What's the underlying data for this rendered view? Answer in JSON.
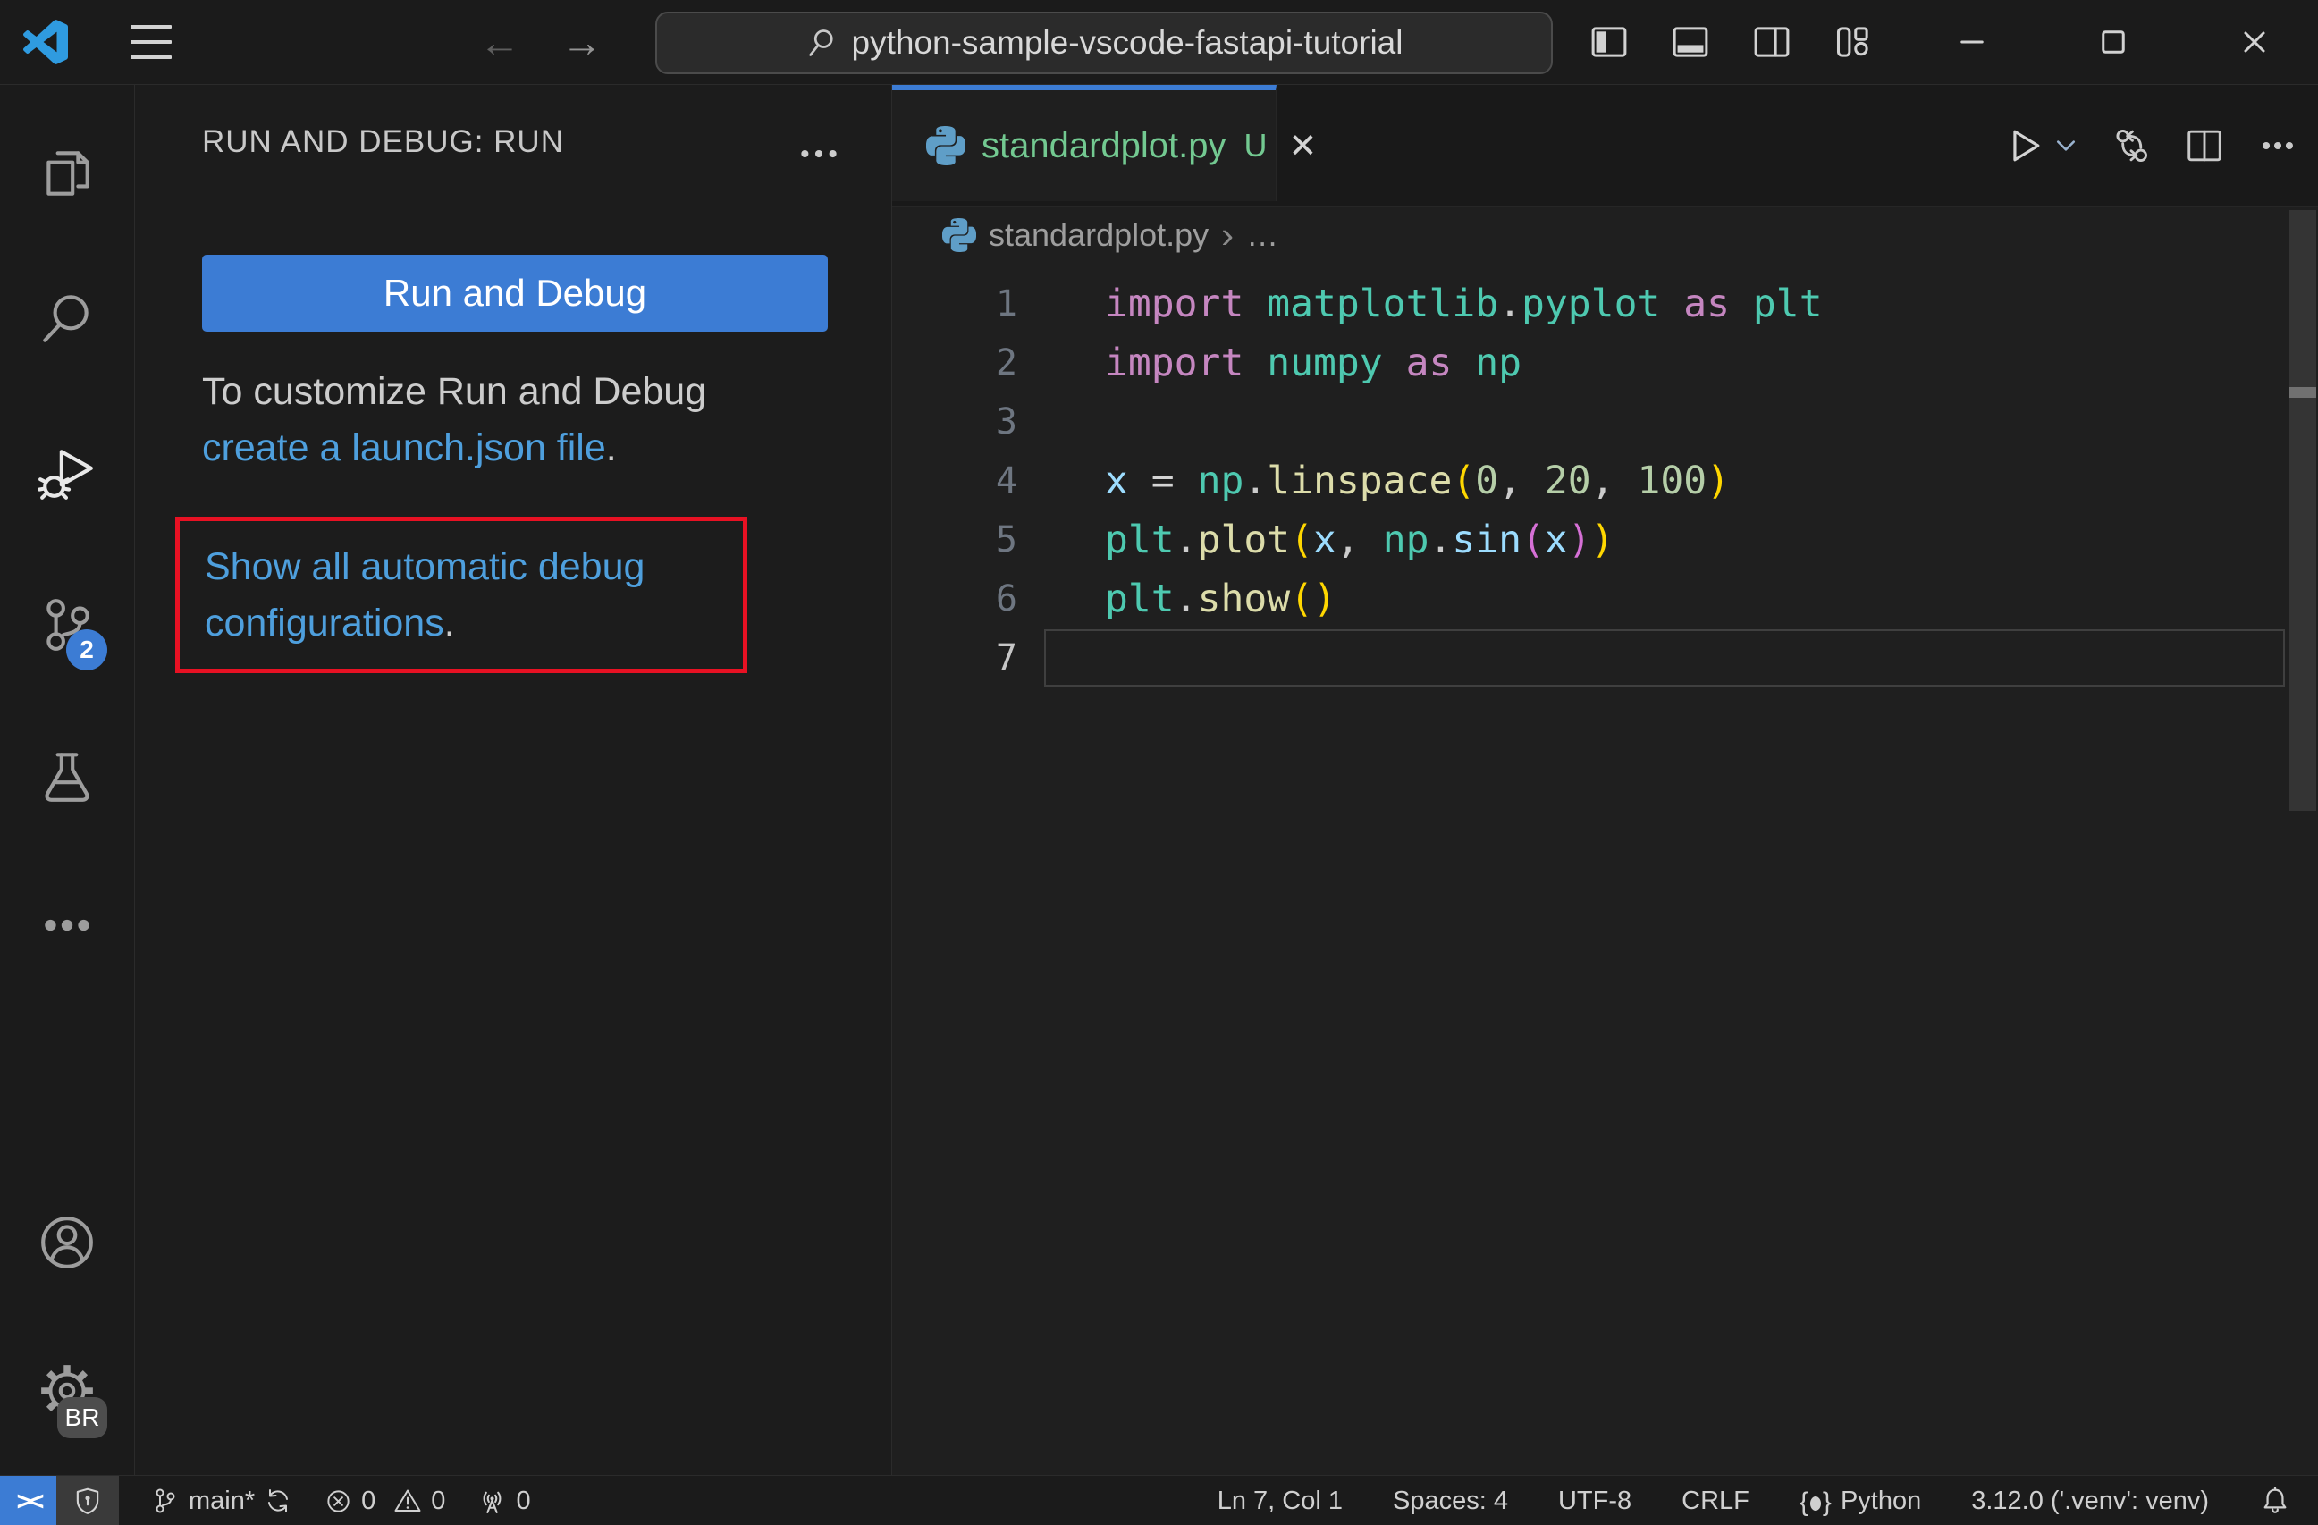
{
  "titlebar": {
    "search_value": "python-sample-vscode-fastapi-tutorial",
    "back_glyph": "←",
    "forward_glyph": "→"
  },
  "activity_bar": {
    "scm_badge": "2",
    "profile_badge": "BR"
  },
  "sidebar": {
    "header": "RUN AND DEBUG: RUN",
    "run_button_label": "Run and Debug",
    "hint_line1": "To customize Run and Debug",
    "hint_link": "create a launch.json file",
    "hint_suffix": ".",
    "highlight_link_line1": "Show all automatic debug",
    "highlight_link_line2": "configurations",
    "highlight_suffix": "."
  },
  "editor": {
    "tab": {
      "file": "standardplot.py",
      "dirty": "U",
      "close_glyph": "✕"
    },
    "breadcrumb": {
      "file": "standardplot.py",
      "separator": "›",
      "ellipsis": "…"
    },
    "code": {
      "token_colors": {
        "kw": "#C586C0",
        "type": "#4EC9B0",
        "fn": "#DCDCAA",
        "var": "#9CDCFE",
        "num": "#B5CEA8",
        "pun": "#CCCCCC",
        "op": "#D4D4D4",
        "b1": "#FFD700",
        "b2": "#D670D6",
        "pl": "#D4D4D4"
      },
      "lines": [
        {
          "num": "1",
          "tokens": [
            [
              "import",
              "kw"
            ],
            [
              " ",
              "pl"
            ],
            [
              "matplotlib",
              "type"
            ],
            [
              ".",
              "pun"
            ],
            [
              "pyplot",
              "type"
            ],
            [
              " ",
              "pl"
            ],
            [
              "as",
              "kw"
            ],
            [
              " ",
              "pl"
            ],
            [
              "plt",
              "type"
            ]
          ]
        },
        {
          "num": "2",
          "tokens": [
            [
              "import",
              "kw"
            ],
            [
              " ",
              "pl"
            ],
            [
              "numpy",
              "type"
            ],
            [
              " ",
              "pl"
            ],
            [
              "as",
              "kw"
            ],
            [
              " ",
              "pl"
            ],
            [
              "np",
              "type"
            ]
          ]
        },
        {
          "num": "3",
          "tokens": []
        },
        {
          "num": "4",
          "tokens": [
            [
              "x",
              "var"
            ],
            [
              " ",
              "pl"
            ],
            [
              "=",
              "op"
            ],
            [
              " ",
              "pl"
            ],
            [
              "np",
              "type"
            ],
            [
              ".",
              "pun"
            ],
            [
              "linspace",
              "fn"
            ],
            [
              "(",
              "b1"
            ],
            [
              "0",
              "num"
            ],
            [
              ",",
              "pun"
            ],
            [
              " ",
              "pl"
            ],
            [
              "20",
              "num"
            ],
            [
              ",",
              "pun"
            ],
            [
              " ",
              "pl"
            ],
            [
              "100",
              "num"
            ],
            [
              ")",
              "b1"
            ]
          ]
        },
        {
          "num": "5",
          "tokens": [
            [
              "plt",
              "type"
            ],
            [
              ".",
              "pun"
            ],
            [
              "plot",
              "fn"
            ],
            [
              "(",
              "b1"
            ],
            [
              "x",
              "var"
            ],
            [
              ",",
              "pun"
            ],
            [
              " ",
              "pl"
            ],
            [
              "np",
              "type"
            ],
            [
              ".",
              "pun"
            ],
            [
              "sin",
              "var"
            ],
            [
              "(",
              "b2"
            ],
            [
              "x",
              "var"
            ],
            [
              ")",
              "b2"
            ],
            [
              ")",
              "b1"
            ]
          ]
        },
        {
          "num": "6",
          "tokens": [
            [
              "plt",
              "type"
            ],
            [
              ".",
              "pun"
            ],
            [
              "show",
              "fn"
            ],
            [
              "(",
              "b1"
            ],
            [
              ")",
              "b1"
            ]
          ]
        },
        {
          "num": "7",
          "tokens": [],
          "current": true
        }
      ]
    }
  },
  "status_bar": {
    "remote_glyph": "><",
    "branch": "main*",
    "errors": "0",
    "warnings": "0",
    "ports": "0",
    "line_col": "Ln 7, Col 1",
    "indentation": "Spaces: 4",
    "encoding": "UTF-8",
    "eol": "CRLF",
    "language": "Python",
    "interpreter": "3.12.0 ('.venv': venv)"
  },
  "colors": {
    "accent_blue": "#3c7cd4",
    "link_blue": "#4e9fdd",
    "highlight_red": "#e81123",
    "untracked_green": "#73C991",
    "editor_bg": "#1f1f1f",
    "chrome_bg": "#1b1b1b"
  }
}
